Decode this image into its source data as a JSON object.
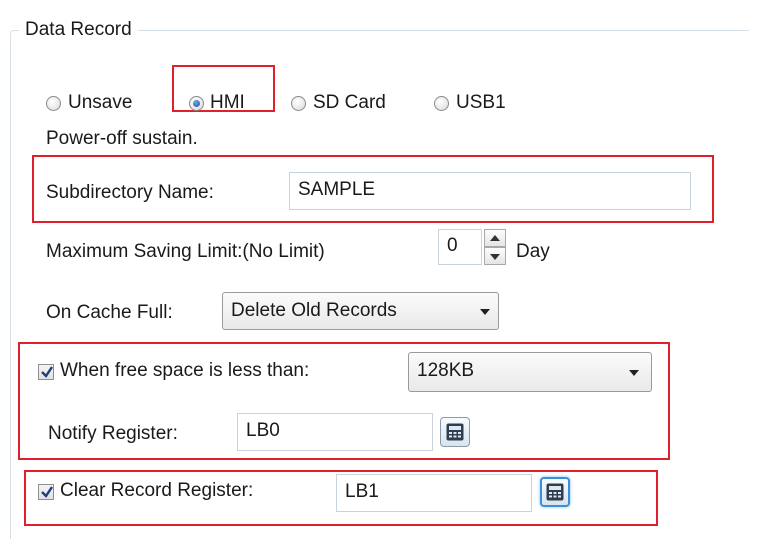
{
  "group": {
    "title": "Data Record"
  },
  "storage": {
    "options": [
      {
        "label": "Unsave",
        "checked": false
      },
      {
        "label": "HMI",
        "checked": true
      },
      {
        "label": "SD Card",
        "checked": false
      },
      {
        "label": "USB1",
        "checked": false
      }
    ],
    "note": "Power-off sustain."
  },
  "subdirectory": {
    "label": "Subdirectory Name:",
    "value": "SAMPLE"
  },
  "max_saving": {
    "label": "Maximum Saving Limit:(No Limit)",
    "value": "0",
    "unit": "Day"
  },
  "cache_full": {
    "label": "On Cache Full:",
    "selected": "Delete Old Records"
  },
  "free_space": {
    "checkbox_label": "When free space is less than:",
    "checked": true,
    "selected": "128KB"
  },
  "notify": {
    "label": "Notify Register:",
    "value": "LB0"
  },
  "clear_record": {
    "checkbox_label": "Clear Record Register:",
    "checked": true,
    "value": "LB1"
  },
  "icons": [
    "calculator-icon",
    "checkmark-icon",
    "radio-dot-icon",
    "dropdown-caret-icon",
    "spin-up-icon",
    "spin-down-icon"
  ],
  "colors": {
    "highlight_border": "#e0202a",
    "radio_selected": "#2c6fb8",
    "group_border": "#d5dfe5"
  }
}
